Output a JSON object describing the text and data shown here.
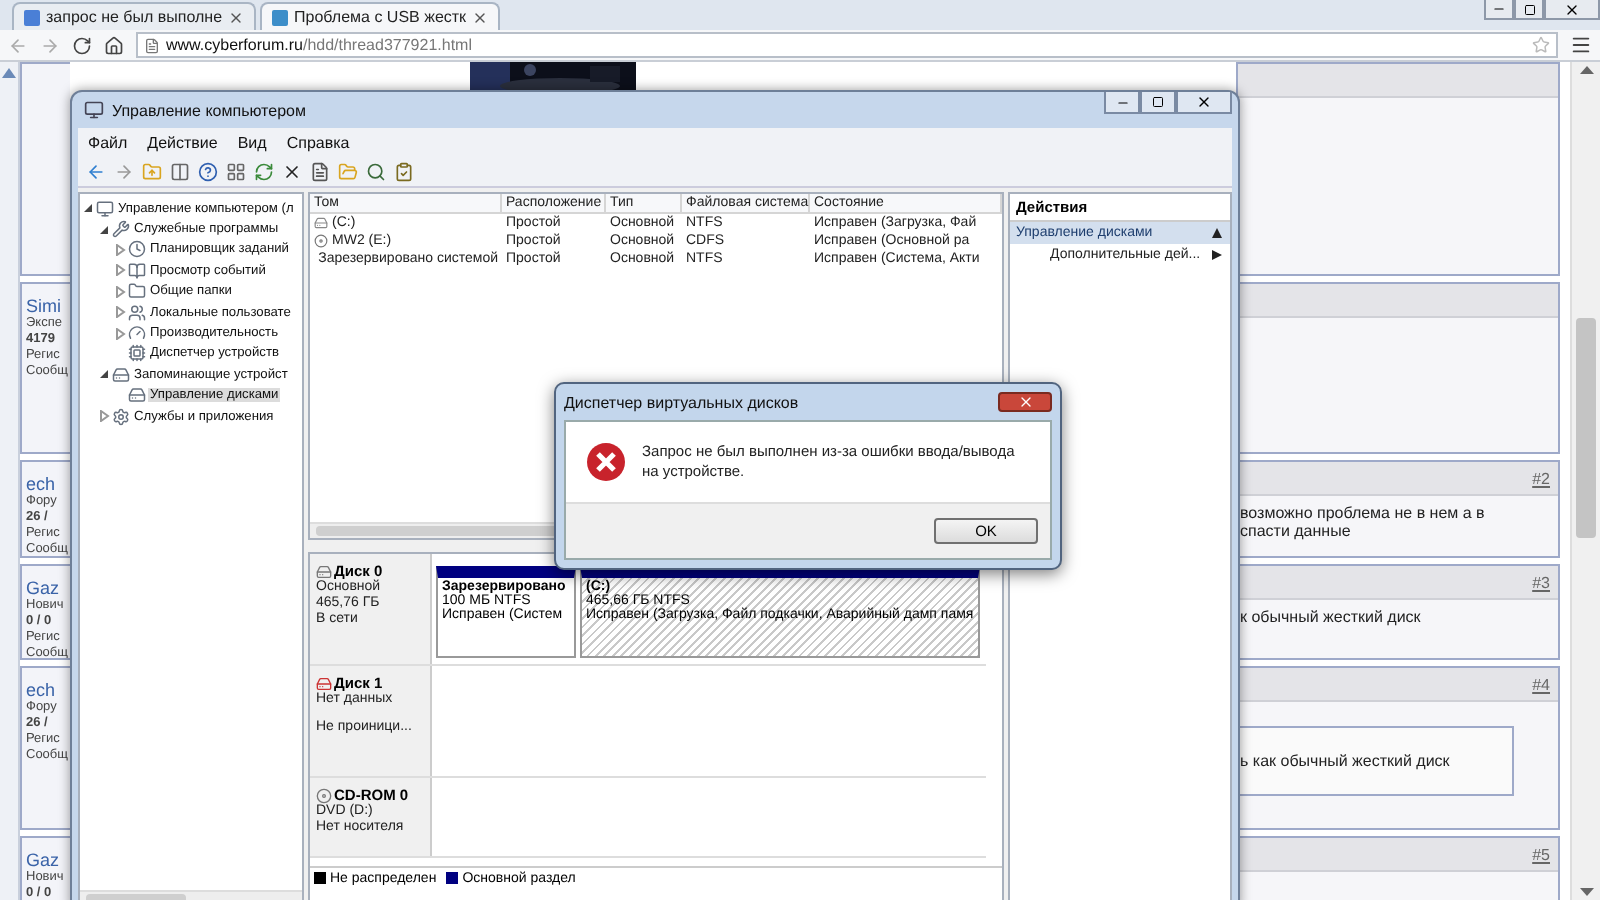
{
  "browser": {
    "tabs": [
      {
        "title": "запрос не был выполне",
        "selected": false
      },
      {
        "title": "Проблема с USB жестк",
        "selected": true
      }
    ],
    "url": {
      "host": "www.cyberforum.ru",
      "path": "/hdd/thread377921.html"
    }
  },
  "forum": {
    "posts": [
      {
        "picture": {
          "kind": "picture"
        }
      },
      {
        "author": "Simi",
        "info": [
          "Экспе",
          "4179",
          "Регис",
          "Сообщ"
        ]
      },
      {
        "author": "ech",
        "info": [
          "Фору",
          "26 /",
          "Регис",
          "Сообщ"
        ],
        "number": "#2",
        "text": [
          "возможно проблема не в нем а в",
          "спасти данные"
        ]
      },
      {
        "author": "Gaz",
        "info": [
          "Нович",
          "0 / 0",
          "Регис",
          "Сообщ"
        ],
        "number": "#3",
        "text": [
          "к обычный жесткий диск"
        ]
      },
      {
        "author": "ech",
        "info": [
          "Фору",
          "26 /",
          "Регис",
          "Сообщ"
        ],
        "number": "#4",
        "quote": "ь как обычный жесткий диск"
      },
      {
        "author": "Gaz",
        "info": [
          "Нович",
          "0 / 0"
        ],
        "number": "#5"
      }
    ]
  },
  "mmc": {
    "title": "Управление компьютером",
    "menu": [
      "Файл",
      "Действие",
      "Вид",
      "Справка"
    ],
    "tree": [
      {
        "label": "Управление компьютером (л",
        "kind": "computer",
        "expanded": true,
        "selected": false,
        "children": [
          {
            "label": "Служебные программы",
            "kind": "tools",
            "expanded": true,
            "selected": false,
            "children": [
              {
                "label": "Планировщик заданий",
                "kind": "clock",
                "expanded": false,
                "selected": false
              },
              {
                "label": "Просмотр событий",
                "kind": "events",
                "expanded": false,
                "selected": false
              },
              {
                "label": "Общие папки",
                "kind": "folder",
                "expanded": false,
                "selected": false
              },
              {
                "label": "Локальные пользовате",
                "kind": "users",
                "expanded": false,
                "selected": false
              },
              {
                "label": "Производительность",
                "kind": "gauge",
                "expanded": false,
                "selected": false
              },
              {
                "label": "Диспетчер устройств",
                "kind": "device",
                "selected": false
              }
            ]
          },
          {
            "label": "Запоминающие устройст",
            "kind": "storage",
            "expanded": true,
            "selected": false,
            "children": [
              {
                "label": "Управление дисками",
                "kind": "disk",
                "selected": true
              }
            ]
          },
          {
            "label": "Службы и приложения",
            "kind": "services",
            "expanded": false,
            "selected": false
          }
        ]
      }
    ],
    "volumes": {
      "columns": [
        "Том",
        "Расположение",
        "Тип",
        "Файловая система",
        "Состояние"
      ],
      "rows": [
        {
          "kind": "drive",
          "cells": [
            "(C:)",
            "Простой",
            "Основной",
            "NTFS",
            "Исправен (Загрузка, Фай"
          ]
        },
        {
          "kind": "cd",
          "cells": [
            "MW2 (E:)",
            "Простой",
            "Основной",
            "CDFS",
            "Исправен (Основной ра"
          ]
        },
        {
          "kind": "drive",
          "cells": [
            "Зарезервировано системой",
            "Простой",
            "Основной",
            "NTFS",
            "Исправен (Система, Акти"
          ]
        }
      ]
    },
    "disks": [
      {
        "name": "Диск 0",
        "kind": "disk",
        "lines": [
          "Основной",
          "465,76 ГБ",
          "В сети"
        ],
        "partitions": [
          {
            "name": "Зарезервировано",
            "size": "100 МБ NTFS",
            "status": "Исправен (Систем",
            "kind": "primary",
            "selected": false
          },
          {
            "name": "(C:)",
            "size": "465,66 ГБ NTFS",
            "status": "Исправен (Загрузка, Файл подкачки, Аварийный дамп памя",
            "kind": "primary",
            "selected": true
          }
        ]
      },
      {
        "name": "Диск 1",
        "kind": "error",
        "lines": [
          "Нет данных",
          "Не проиници..."
        ]
      },
      {
        "name": "CD-ROM 0",
        "kind": "cdrom",
        "lines": [
          "DVD (D:)",
          "Нет носителя"
        ]
      }
    ],
    "legend": [
      {
        "label": "Не распределен",
        "kind": "unallocated",
        "color": "#000000"
      },
      {
        "label": "Основной раздел",
        "kind": "primary",
        "color": "#000080"
      }
    ],
    "actions": {
      "title": "Действия",
      "items": [
        {
          "label": "Управление дисками",
          "kind": "section"
        },
        {
          "label": "Дополнительные дей...",
          "kind": "submenu"
        }
      ]
    }
  },
  "dialog": {
    "title": "Диспетчер виртуальных дисков",
    "message": "Запрос не был выполнен из-за ошибки ввода/вывода на устройстве.",
    "button": "OK"
  }
}
